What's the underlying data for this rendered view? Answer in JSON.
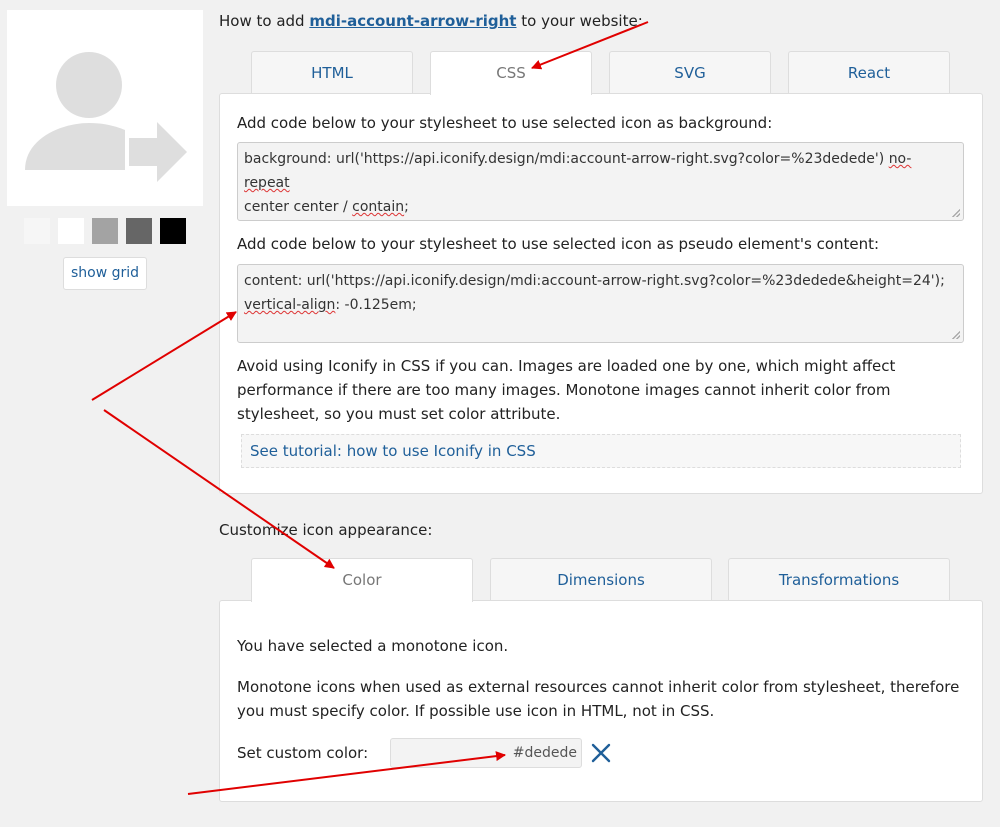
{
  "preview": {
    "swatches": [
      "#f6f6f6",
      "#ffffff",
      "#a3a3a3",
      "#666666",
      "#000000"
    ],
    "show_grid_label": "show grid",
    "icon_color": "#dedede"
  },
  "howto": {
    "prefix": "How to add",
    "icon_name": "mdi-account-arrow-right",
    "suffix": "to your website:"
  },
  "code_tabs": [
    {
      "label": "HTML",
      "active": false
    },
    {
      "label": "CSS",
      "active": true
    },
    {
      "label": "SVG",
      "active": false
    },
    {
      "label": "React",
      "active": false
    }
  ],
  "css_panel": {
    "bg_intro": "Add code below to your stylesheet to use selected icon as background:",
    "bg_code_a": "background: url('https://api.iconify.design/mdi:account-arrow-right.svg?color=%23dedede')",
    "bg_code_b": "no-repeat",
    "bg_code_c": "center center /",
    "bg_code_d": "contain",
    "bg_code_e": ";",
    "pseudo_intro": "Add code below to your stylesheet to use selected icon as pseudo element's content:",
    "pseudo_code_a": "content: url('https://api.iconify.design/mdi:account-arrow-right.svg?color=%23dedede&height=24');",
    "pseudo_code_b": "vertical-align",
    "pseudo_code_c": ": -0.125em;",
    "warning": "Avoid using Iconify in CSS if you can. Images are loaded one by one, which might affect performance if there are too many images. Monotone images cannot inherit color from stylesheet, so you must set color attribute.",
    "tutorial_link": "See tutorial: how to use Iconify in CSS"
  },
  "customize_title": "Customize icon appearance:",
  "custom_tabs": [
    {
      "label": "Color",
      "active": true
    },
    {
      "label": "Dimensions",
      "active": false
    },
    {
      "label": "Transformations",
      "active": false
    }
  ],
  "color_panel": {
    "selected_text": "You have selected a monotone icon.",
    "explain_text": "Monotone icons when used as external resources cannot inherit color from stylesheet, therefore you must specify color. If possible use icon in HTML, not in CSS.",
    "custom_color_label": "Set custom color:",
    "custom_color_value": "#dedede"
  },
  "colors": {
    "link": "#1f5f99",
    "annotation_arrow": "#e00000"
  }
}
